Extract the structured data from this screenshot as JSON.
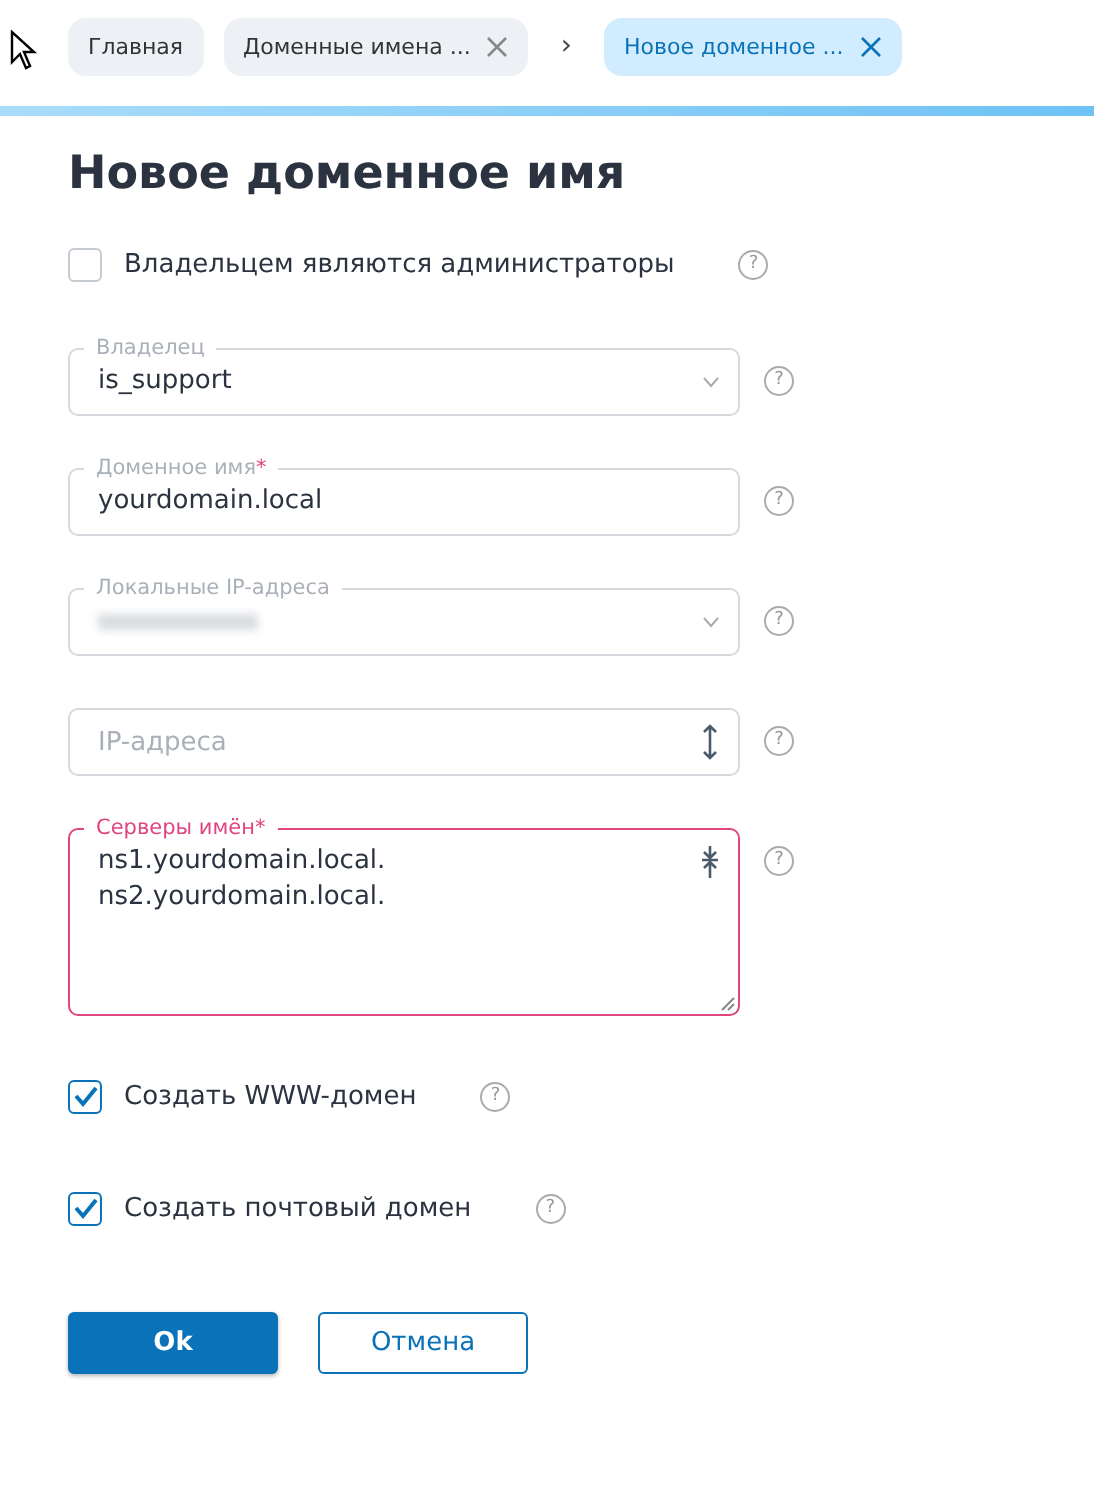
{
  "tabs": [
    {
      "label": "Главная",
      "closable": false,
      "selected": false
    },
    {
      "label": "Доменные имена ...",
      "closable": true,
      "selected": false
    },
    {
      "label": "Новое доменное ...",
      "closable": true,
      "selected": true
    }
  ],
  "breadcrumb_separator": "›",
  "title": "Новое доменное имя",
  "admin_owner": {
    "label": "Владельцем являются администраторы",
    "checked": false,
    "help": "?"
  },
  "fields": [
    {
      "kind": "select",
      "label": "Владелец",
      "value": "is_support",
      "invalid": false,
      "help": "?"
    },
    {
      "kind": "input",
      "label": "Доменное имя",
      "required_mark": "*",
      "value": "yourdomain.local",
      "invalid": false,
      "help": "?"
    },
    {
      "kind": "select",
      "label": "Локальные IP-адреса",
      "redacted": true,
      "invalid": false,
      "help": "?"
    },
    {
      "kind": "expandable",
      "placeholder": "IP-адреса",
      "invalid": false,
      "help": "?"
    },
    {
      "kind": "textarea",
      "label": "Серверы имён",
      "required_mark": "*",
      "value": "ns1.yourdomain.local.\nns2.yourdomain.local.",
      "invalid": true,
      "help": "?"
    }
  ],
  "options": [
    {
      "label": "Создать WWW-домен",
      "checked": true,
      "help": "?"
    },
    {
      "label": "Создать почтовый домен",
      "checked": true,
      "help": "?"
    }
  ],
  "buttons": [
    {
      "label": "Ok",
      "primary": true
    },
    {
      "label": "Отмена",
      "primary": false
    }
  ]
}
